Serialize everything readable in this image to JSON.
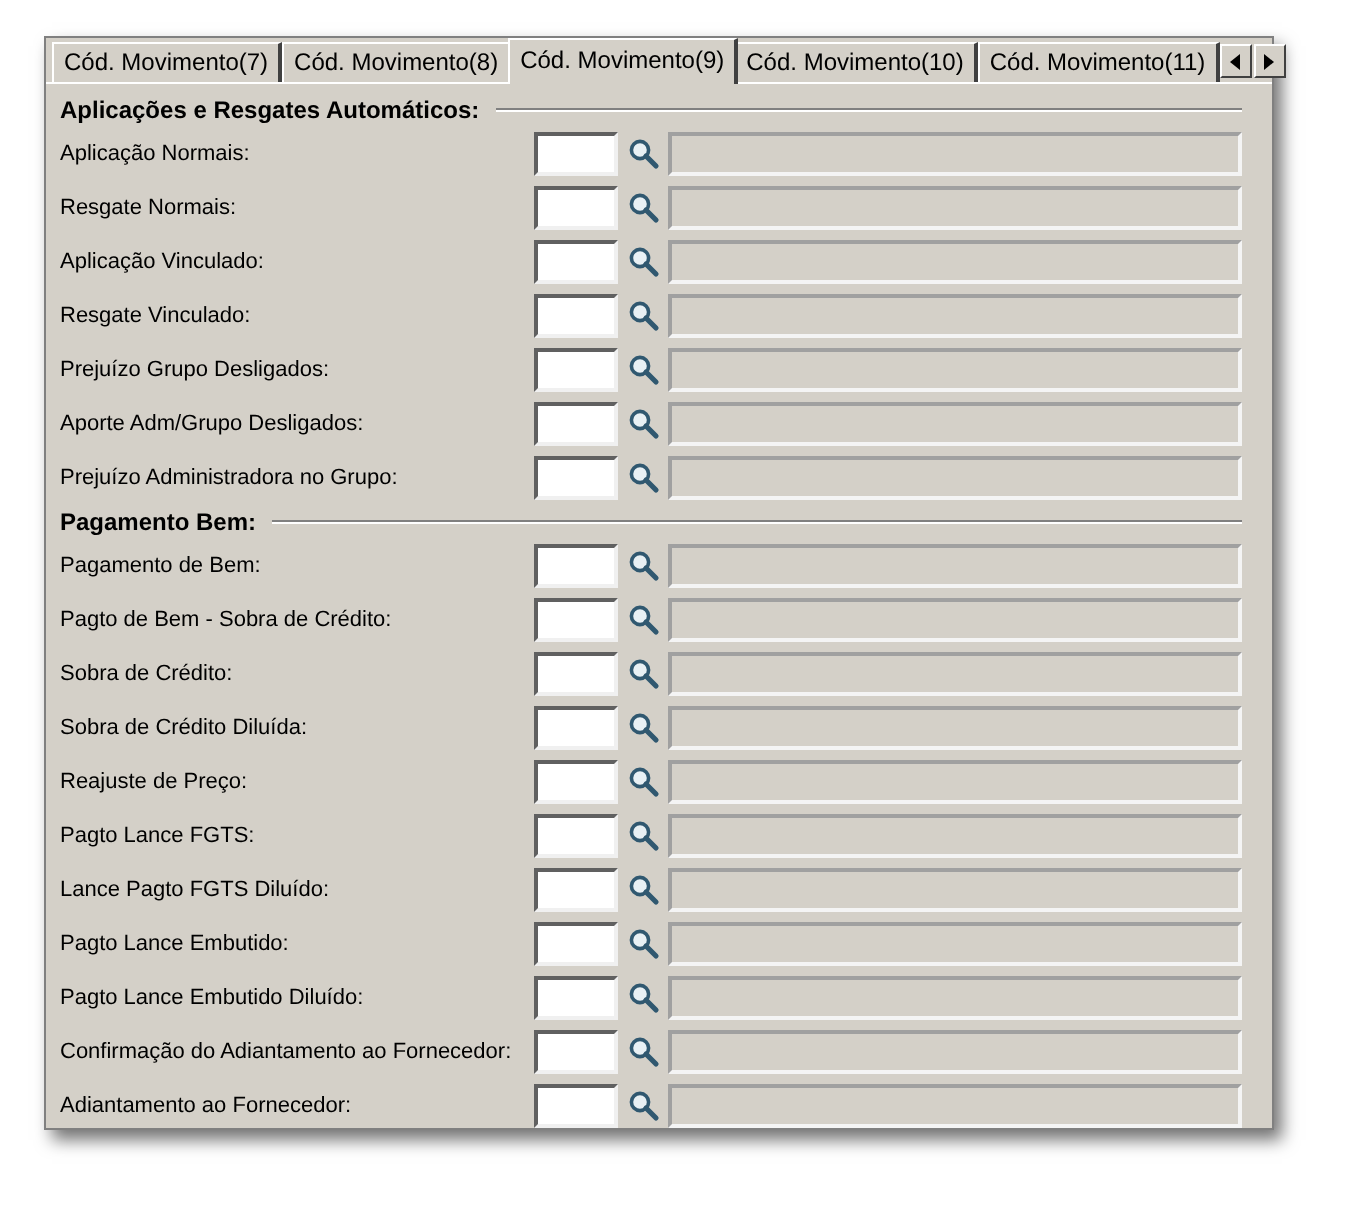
{
  "tabs": [
    {
      "label": "Cód. Movimento(7)",
      "selected": false
    },
    {
      "label": "Cód. Movimento(8)",
      "selected": false
    },
    {
      "label": "Cód. Movimento(9)",
      "selected": true
    },
    {
      "label": "Cód. Movimento(10)",
      "selected": false
    },
    {
      "label": "Cód. Movimento(11)",
      "selected": false
    }
  ],
  "sections": [
    {
      "heading": "Aplicações e Resgates Automáticos:",
      "rows": [
        {
          "label": "Aplicação Normais:"
        },
        {
          "label": "Resgate Normais:"
        },
        {
          "label": "Aplicação Vinculado:"
        },
        {
          "label": "Resgate Vinculado:"
        },
        {
          "label": "Prejuízo Grupo Desligados:"
        },
        {
          "label": "Aporte Adm/Grupo Desligados:"
        },
        {
          "label": "Prejuízo Administradora no Grupo:"
        }
      ]
    },
    {
      "heading": "Pagamento Bem:",
      "rows": [
        {
          "label": "Pagamento de Bem:"
        },
        {
          "label": "Pagto de Bem - Sobra de Crédito:"
        },
        {
          "label": "Sobra de Crédito:"
        },
        {
          "label": "Sobra de Crédito Diluída:"
        },
        {
          "label": "Reajuste de Preço:"
        },
        {
          "label": "Pagto Lance FGTS:"
        },
        {
          "label": "Lance Pagto FGTS Diluído:"
        },
        {
          "label": "Pagto Lance Embutido:"
        },
        {
          "label": "Pagto Lance Embutido Diluído:"
        },
        {
          "label": "Confirmação do Adiantamento ao Fornecedor:"
        },
        {
          "label": "Adiantamento ao Fornecedor:"
        }
      ]
    }
  ]
}
